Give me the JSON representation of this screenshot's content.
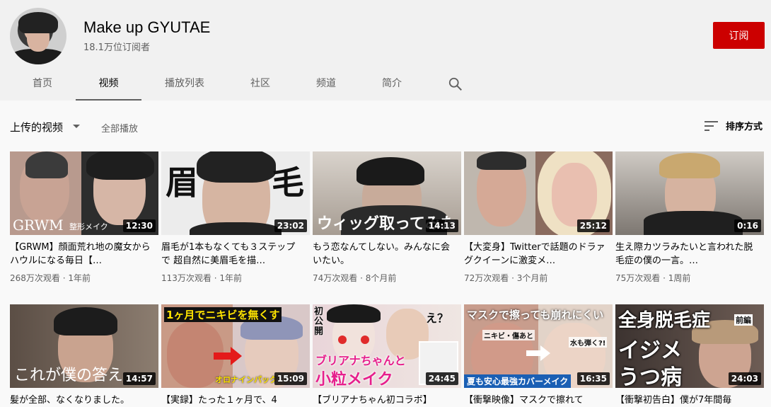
{
  "channel": {
    "name": "Make up GYUTAE",
    "subscribers": "18.1万位订阅者",
    "subscribe_label": "订阅"
  },
  "tabs": [
    {
      "label": "首页"
    },
    {
      "label": "视频"
    },
    {
      "label": "播放列表"
    },
    {
      "label": "社区"
    },
    {
      "label": "频道"
    },
    {
      "label": "简介"
    }
  ],
  "active_tab": "视频",
  "section": {
    "uploads_label": "上传的视频",
    "play_all_label": "全部播放",
    "sort_label": "排序方式"
  },
  "videos": [
    {
      "title": "【GRWM】顔面荒れ地の魔女からハウルになる毎日【…",
      "duration": "12:30",
      "meta": "268万次观看 · 1年前",
      "overlay": [
        "GRWM",
        "整形メイク"
      ]
    },
    {
      "title": "眉毛が1本もなくても３ステップで 超自然に美眉毛を描…",
      "duration": "23:02",
      "meta": "113万次观看 · 1年前",
      "overlay": [
        "眉",
        "毛"
      ]
    },
    {
      "title": "もう恋なんてしない。みんなに会いたい。",
      "duration": "14:13",
      "meta": "74万次观看 · 8个月前",
      "overlay": [
        "ウィッグ取ってみた"
      ]
    },
    {
      "title": "【大変身】Twitterで話題のドラァグクイーンに激変メ…",
      "duration": "25:12",
      "meta": "72万次观看 · 3个月前",
      "overlay": []
    },
    {
      "title": "生え際カツラみたいと言われた脱毛症の僕の一言。…",
      "duration": "0:16",
      "meta": "75万次观看 · 1周前",
      "overlay": []
    },
    {
      "title": "髪が全部、なくなりました。",
      "duration": "14:57",
      "meta": "",
      "overlay": [
        "これが僕の答え"
      ]
    },
    {
      "title": "【実録】たった１ヶ月で、4",
      "duration": "15:09",
      "meta": "",
      "overlay": [
        "1ヶ月でニキビを無くす",
        "オロナインパック"
      ]
    },
    {
      "title": "【ブリアナちゃん初コラボ】",
      "duration": "24:45",
      "meta": "",
      "overlay": [
        "初公開",
        "え？",
        "ブリアナちゃんと",
        "小粒メイク"
      ]
    },
    {
      "title": "【衝撃映像】マスクで擦れて",
      "duration": "16:35",
      "meta": "",
      "overlay": [
        "マスクで擦っても崩れにくい",
        "ニキビ・傷あと",
        "水も弾く?!",
        "夏も安心最強カバーメイク"
      ]
    },
    {
      "title": "【衝撃初告白】僕が7年間毎",
      "duration": "24:03",
      "meta": "",
      "overlay": [
        "全身脱毛症",
        "前編",
        "イジメ",
        "うつ病"
      ]
    }
  ],
  "colors": {
    "accent_red": "#cc0000",
    "header_bg": "#f1f1f1",
    "page_bg": "#f9f9f9"
  },
  "icons": [
    "search-icon",
    "sort-icon",
    "caret-down-icon"
  ]
}
